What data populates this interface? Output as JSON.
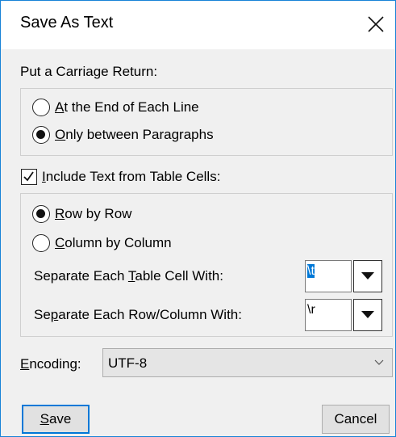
{
  "window": {
    "title": "Save As Text"
  },
  "carriage_return": {
    "label": "Put a Carriage Return:",
    "options": [
      {
        "mnemonic": "A",
        "rest": "t the End of Each Line",
        "selected": false
      },
      {
        "mnemonic": "O",
        "rest": "nly between Paragraphs",
        "selected": true
      }
    ]
  },
  "table_cells": {
    "checkbox": {
      "mnemonic": "I",
      "rest": "nclude Text from Table Cells:",
      "checked": true
    },
    "order_options": [
      {
        "mnemonic": "R",
        "rest": "ow by Row",
        "selected": true
      },
      {
        "mnemonic": "C",
        "rest": "olumn by Column",
        "selected": false
      }
    ],
    "cell_separator": {
      "pre": "Separate Each ",
      "mnemonic": "T",
      "post": "able Cell With:",
      "value": "\\t"
    },
    "row_separator": {
      "pre": "Se",
      "mnemonic": "p",
      "post": "arate Each Row/Column With:",
      "value": "\\r"
    }
  },
  "encoding": {
    "mnemonic": "E",
    "rest": "ncoding:",
    "value": "UTF-8"
  },
  "buttons": {
    "save": {
      "mnemonic": "S",
      "rest": "ave"
    },
    "cancel": "Cancel"
  },
  "colors": {
    "accent": "#0078d7",
    "window_border": "#1883d7",
    "background": "#f0f0f0"
  },
  "icons": {
    "close": "close-icon",
    "dropdown": "triangle-down-icon",
    "chevron": "chevron-down-icon",
    "check": "checkmark-icon"
  }
}
